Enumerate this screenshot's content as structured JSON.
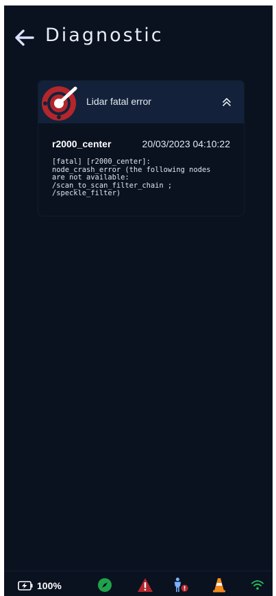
{
  "header": {
    "title": "Diagnostic",
    "back_icon": "arrow-left-icon"
  },
  "colors": {
    "background": "#0a1220",
    "card_header": "#13223a",
    "error_red": "#b3262c",
    "success_green": "#1fa34a",
    "cone_orange": "#f28a1b",
    "wifi_green": "#22c55e"
  },
  "diagnostics": [
    {
      "title": "Lidar fatal error",
      "icon": "lidar-radar-icon",
      "expanded": true,
      "node": "r2000_center",
      "timestamp": "20/03/2023 04:10:22",
      "message": "[fatal] [r2000_center]:\nnode_crash_error (the following nodes\nare not available:\n/scan_to_scan_filter_chain ;\n/speckle_filter)"
    }
  ],
  "status_bar": {
    "battery_icon": "battery-charging-icon",
    "battery_level": "100%",
    "icons": [
      "compass-icon",
      "warning-triangle-icon",
      "person-alert-icon",
      "traffic-cone-icon",
      "wifi-icon"
    ]
  }
}
